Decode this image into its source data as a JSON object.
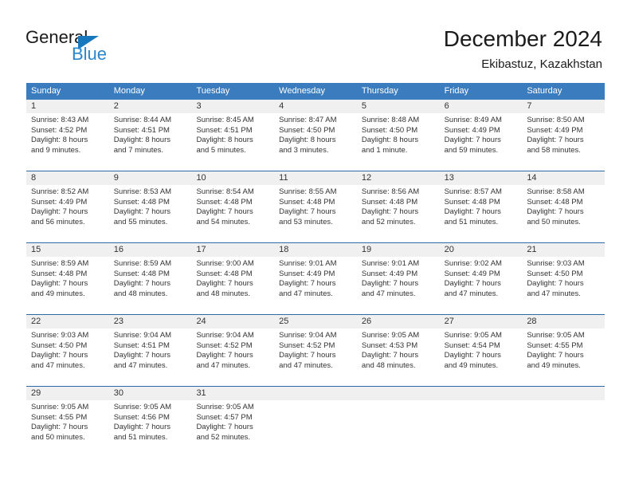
{
  "branding": {
    "name_dark": "General",
    "name_blue": "Blue",
    "triangle_color": "#1878be",
    "blue_color": "#2b86cc"
  },
  "header": {
    "title": "December 2024",
    "subtitle": "Ekibastuz, Kazakhstan"
  },
  "theme": {
    "header_blue": "#3a7cbe",
    "separator_blue": "#2c6aa8",
    "day_band_gray": "#f0f0f0"
  },
  "weekdays": [
    "Sunday",
    "Monday",
    "Tuesday",
    "Wednesday",
    "Thursday",
    "Friday",
    "Saturday"
  ],
  "weeks": [
    [
      {
        "day": "1",
        "lines": [
          "Sunrise: 8:43 AM",
          "Sunset: 4:52 PM",
          "Daylight: 8 hours",
          "and 9 minutes."
        ]
      },
      {
        "day": "2",
        "lines": [
          "Sunrise: 8:44 AM",
          "Sunset: 4:51 PM",
          "Daylight: 8 hours",
          "and 7 minutes."
        ]
      },
      {
        "day": "3",
        "lines": [
          "Sunrise: 8:45 AM",
          "Sunset: 4:51 PM",
          "Daylight: 8 hours",
          "and 5 minutes."
        ]
      },
      {
        "day": "4",
        "lines": [
          "Sunrise: 8:47 AM",
          "Sunset: 4:50 PM",
          "Daylight: 8 hours",
          "and 3 minutes."
        ]
      },
      {
        "day": "5",
        "lines": [
          "Sunrise: 8:48 AM",
          "Sunset: 4:50 PM",
          "Daylight: 8 hours",
          "and 1 minute."
        ]
      },
      {
        "day": "6",
        "lines": [
          "Sunrise: 8:49 AM",
          "Sunset: 4:49 PM",
          "Daylight: 7 hours",
          "and 59 minutes."
        ]
      },
      {
        "day": "7",
        "lines": [
          "Sunrise: 8:50 AM",
          "Sunset: 4:49 PM",
          "Daylight: 7 hours",
          "and 58 minutes."
        ]
      }
    ],
    [
      {
        "day": "8",
        "lines": [
          "Sunrise: 8:52 AM",
          "Sunset: 4:49 PM",
          "Daylight: 7 hours",
          "and 56 minutes."
        ]
      },
      {
        "day": "9",
        "lines": [
          "Sunrise: 8:53 AM",
          "Sunset: 4:48 PM",
          "Daylight: 7 hours",
          "and 55 minutes."
        ]
      },
      {
        "day": "10",
        "lines": [
          "Sunrise: 8:54 AM",
          "Sunset: 4:48 PM",
          "Daylight: 7 hours",
          "and 54 minutes."
        ]
      },
      {
        "day": "11",
        "lines": [
          "Sunrise: 8:55 AM",
          "Sunset: 4:48 PM",
          "Daylight: 7 hours",
          "and 53 minutes."
        ]
      },
      {
        "day": "12",
        "lines": [
          "Sunrise: 8:56 AM",
          "Sunset: 4:48 PM",
          "Daylight: 7 hours",
          "and 52 minutes."
        ]
      },
      {
        "day": "13",
        "lines": [
          "Sunrise: 8:57 AM",
          "Sunset: 4:48 PM",
          "Daylight: 7 hours",
          "and 51 minutes."
        ]
      },
      {
        "day": "14",
        "lines": [
          "Sunrise: 8:58 AM",
          "Sunset: 4:48 PM",
          "Daylight: 7 hours",
          "and 50 minutes."
        ]
      }
    ],
    [
      {
        "day": "15",
        "lines": [
          "Sunrise: 8:59 AM",
          "Sunset: 4:48 PM",
          "Daylight: 7 hours",
          "and 49 minutes."
        ]
      },
      {
        "day": "16",
        "lines": [
          "Sunrise: 8:59 AM",
          "Sunset: 4:48 PM",
          "Daylight: 7 hours",
          "and 48 minutes."
        ]
      },
      {
        "day": "17",
        "lines": [
          "Sunrise: 9:00 AM",
          "Sunset: 4:48 PM",
          "Daylight: 7 hours",
          "and 48 minutes."
        ]
      },
      {
        "day": "18",
        "lines": [
          "Sunrise: 9:01 AM",
          "Sunset: 4:49 PM",
          "Daylight: 7 hours",
          "and 47 minutes."
        ]
      },
      {
        "day": "19",
        "lines": [
          "Sunrise: 9:01 AM",
          "Sunset: 4:49 PM",
          "Daylight: 7 hours",
          "and 47 minutes."
        ]
      },
      {
        "day": "20",
        "lines": [
          "Sunrise: 9:02 AM",
          "Sunset: 4:49 PM",
          "Daylight: 7 hours",
          "and 47 minutes."
        ]
      },
      {
        "day": "21",
        "lines": [
          "Sunrise: 9:03 AM",
          "Sunset: 4:50 PM",
          "Daylight: 7 hours",
          "and 47 minutes."
        ]
      }
    ],
    [
      {
        "day": "22",
        "lines": [
          "Sunrise: 9:03 AM",
          "Sunset: 4:50 PM",
          "Daylight: 7 hours",
          "and 47 minutes."
        ]
      },
      {
        "day": "23",
        "lines": [
          "Sunrise: 9:04 AM",
          "Sunset: 4:51 PM",
          "Daylight: 7 hours",
          "and 47 minutes."
        ]
      },
      {
        "day": "24",
        "lines": [
          "Sunrise: 9:04 AM",
          "Sunset: 4:52 PM",
          "Daylight: 7 hours",
          "and 47 minutes."
        ]
      },
      {
        "day": "25",
        "lines": [
          "Sunrise: 9:04 AM",
          "Sunset: 4:52 PM",
          "Daylight: 7 hours",
          "and 47 minutes."
        ]
      },
      {
        "day": "26",
        "lines": [
          "Sunrise: 9:05 AM",
          "Sunset: 4:53 PM",
          "Daylight: 7 hours",
          "and 48 minutes."
        ]
      },
      {
        "day": "27",
        "lines": [
          "Sunrise: 9:05 AM",
          "Sunset: 4:54 PM",
          "Daylight: 7 hours",
          "and 49 minutes."
        ]
      },
      {
        "day": "28",
        "lines": [
          "Sunrise: 9:05 AM",
          "Sunset: 4:55 PM",
          "Daylight: 7 hours",
          "and 49 minutes."
        ]
      }
    ],
    [
      {
        "day": "29",
        "lines": [
          "Sunrise: 9:05 AM",
          "Sunset: 4:55 PM",
          "Daylight: 7 hours",
          "and 50 minutes."
        ]
      },
      {
        "day": "30",
        "lines": [
          "Sunrise: 9:05 AM",
          "Sunset: 4:56 PM",
          "Daylight: 7 hours",
          "and 51 minutes."
        ]
      },
      {
        "day": "31",
        "lines": [
          "Sunrise: 9:05 AM",
          "Sunset: 4:57 PM",
          "Daylight: 7 hours",
          "and 52 minutes."
        ]
      },
      {
        "day": "",
        "lines": []
      },
      {
        "day": "",
        "lines": []
      },
      {
        "day": "",
        "lines": []
      },
      {
        "day": "",
        "lines": []
      }
    ]
  ]
}
